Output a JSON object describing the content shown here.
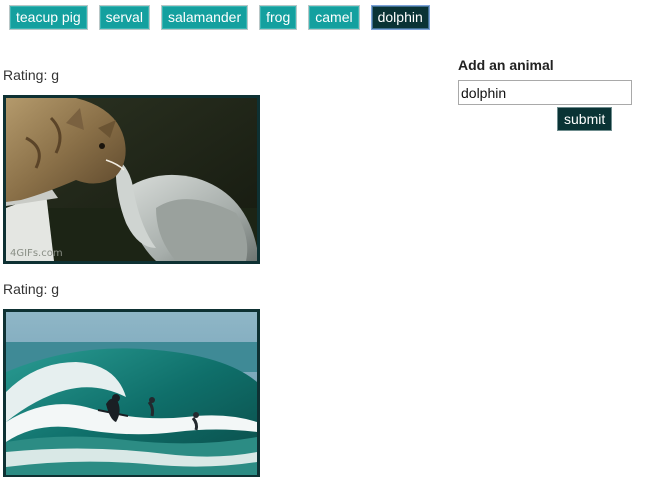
{
  "animals": [
    {
      "label": "teacup pig",
      "active": false
    },
    {
      "label": "serval",
      "active": false
    },
    {
      "label": "salamander",
      "active": false
    },
    {
      "label": "frog",
      "active": false
    },
    {
      "label": "camel",
      "active": false
    },
    {
      "label": "dolphin",
      "active": true
    }
  ],
  "results": [
    {
      "rating": "Rating: g",
      "watermark": "4GIFs.com"
    },
    {
      "rating": "Rating: g"
    }
  ],
  "form": {
    "title": "Add an animal",
    "input_value": "dolphin",
    "submit_label": "submit"
  },
  "colors": {
    "button_bg": "#14a09f",
    "button_active_bg": "#0a3335",
    "frame_border": "#0e3133"
  }
}
